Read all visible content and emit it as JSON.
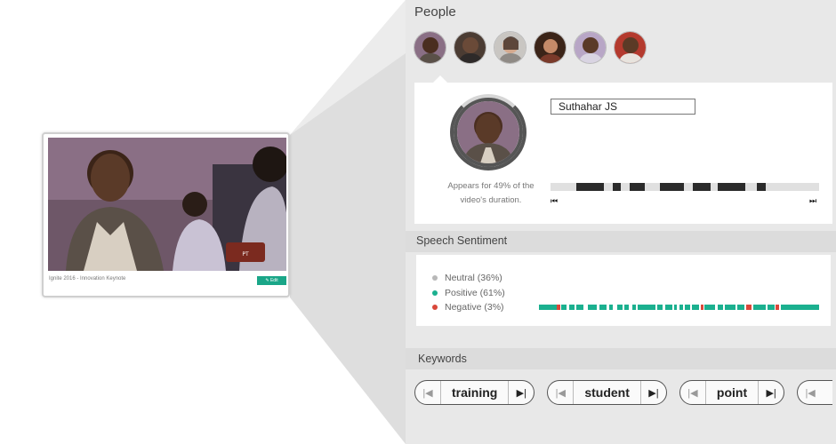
{
  "thumbnail": {
    "caption": "Ignite 2016 - Innovation Keynote",
    "button_label": "✎ Edit",
    "overlay_text": "puthiyathalaimurai"
  },
  "people": {
    "title": "People",
    "avatar_count": 6,
    "selected": {
      "name": "Suthahar JS",
      "appears_text": "Appears for 49% of the video's duration.",
      "appearance_percent": 49
    },
    "timeline_prev_icon": "skip-previous-icon",
    "timeline_next_icon": "skip-next-icon"
  },
  "speech_sentiment": {
    "title": "Speech Sentiment",
    "legend": [
      {
        "label": "Neutral (36%)",
        "color": "#b8b8b8"
      },
      {
        "label": "Positive (61%)",
        "color": "#1bb08f"
      },
      {
        "label": "Negative (3%)",
        "color": "#d9473a"
      }
    ]
  },
  "keywords": {
    "title": "Keywords",
    "items": [
      {
        "label": "training"
      },
      {
        "label": "student"
      },
      {
        "label": "point"
      },
      {
        "label": ""
      }
    ]
  },
  "colors": {
    "panel_bg": "#e8e8e8",
    "accent": "#1bb08f",
    "negative": "#d9473a",
    "timeline_fill": "#2b2b2b"
  }
}
